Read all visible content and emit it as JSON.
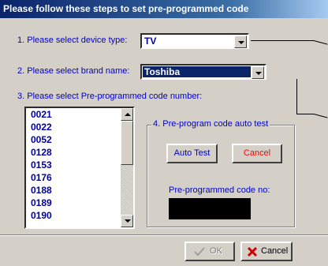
{
  "window": {
    "title": "Please follow these steps to set pre-programmed code"
  },
  "step1": {
    "label": "1. Please select device type:",
    "value": "TV"
  },
  "step2": {
    "label": "2. Please select brand name:",
    "value": "Toshiba"
  },
  "step3": {
    "label": "3. Please select Pre-programmed code number:",
    "codes": [
      "0021",
      "0022",
      "0052",
      "0128",
      "0153",
      "0176",
      "0188",
      "0189",
      "0190"
    ]
  },
  "step4": {
    "label": "4. Pre-program code auto test",
    "auto_test_label": "Auto Test",
    "cancel_label": "Cancel",
    "code_label": "Pre-programmed code no:"
  },
  "footer": {
    "ok_label": "OK",
    "cancel_label": "Cancel"
  },
  "colors": {
    "title_start": "#0a246a",
    "label_blue": "#0000c8",
    "cancel_red": "#ff0000"
  }
}
